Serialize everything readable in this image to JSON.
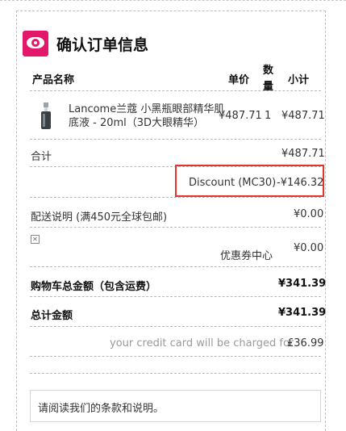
{
  "header": {
    "title": "确认订单信息",
    "icon": "eye-icon",
    "icon_color": "#e4186b"
  },
  "columns": {
    "product": "产品名称",
    "price": "单价",
    "qty_line1": "数",
    "qty_line2": "量",
    "subtotal": "小计"
  },
  "item": {
    "name_line1": "Lancome兰蔻 小黑瓶眼部精华肌",
    "name_line2": "底液 - 20ml（3D大眼精华）",
    "price": "¥487.71",
    "qty": "1",
    "subtotal": "¥487.71"
  },
  "summary": {
    "total_label": "合计",
    "total_value": "¥487.71",
    "discount_label": "Discount (MC30)",
    "discount_value": "-¥146.32",
    "shipping_label": "配送说明 (满450元全球包邮)",
    "shipping_value": "¥0.00",
    "coupon_label": "优惠券中心",
    "coupon_value": "¥0.00",
    "cart_total_label": "购物车总金额（包含运费）",
    "cart_total_value": "¥341.39",
    "grand_total_label": "总计金额",
    "grand_total_value": "¥341.39",
    "charge_label": "your credit card will be charged for",
    "charge_value": "£36.99"
  },
  "notice": {
    "text": "请阅读我们的条款和说明。"
  },
  "colors": {
    "accent": "#e4186b",
    "highlight_border": "#e0342c"
  }
}
